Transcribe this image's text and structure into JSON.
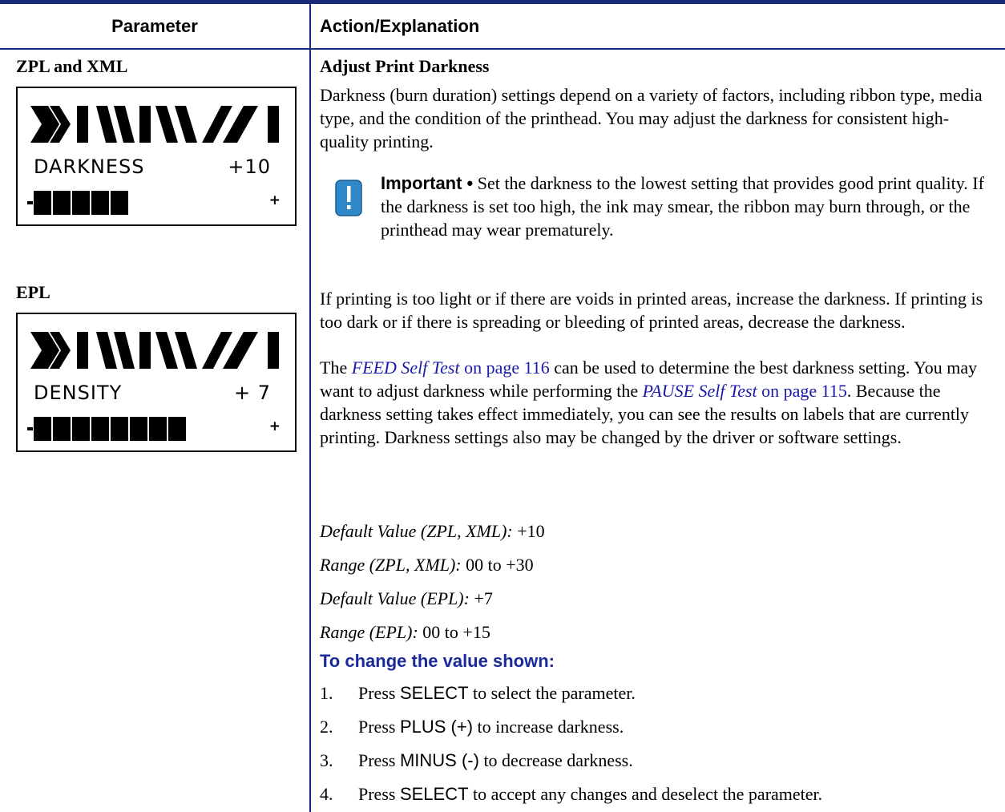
{
  "table": {
    "header_parameter": "Parameter",
    "header_action": "Action/Explanation"
  },
  "left": {
    "zpl_label": "ZPL and XML",
    "zpl_display": {
      "name": "DARKNESS",
      "value": "+10",
      "minus": "-",
      "plus": "+",
      "bar_blocks": 5
    },
    "epl_label": "EPL",
    "epl_display": {
      "name": "DENSITY",
      "value": "+ 7",
      "minus": "-",
      "plus": "+",
      "bar_blocks": 8
    }
  },
  "content": {
    "title": "Adjust Print Darkness",
    "intro": "Darkness (burn duration) settings depend on a variety of factors, including ribbon type, media type, and the condition of the printhead. You may adjust the darkness for consistent high-quality printing.",
    "important_label": "Important •",
    "important_text": "Set the darkness to the lowest setting that provides good print quality. If the darkness is set too high, the ink may smear, the ribbon may burn through, or the printhead may wear prematurely.",
    "para2": "If printing is too light or if there are voids in printed areas, increase the darkness. If printing is too dark or if there is spreading or bleeding of printed areas, decrease the darkness.",
    "para3_pre": "The ",
    "feed_link": "FEED Self Test",
    "feed_page": " on page 116",
    "para3_mid": " can be used to determine the best darkness setting. You may want to adjust darkness while performing the ",
    "pause_link": "PAUSE Self Test",
    "pause_page": " on page 115",
    "para3_post": ". Because the darkness setting takes effect immediately, you can see the results on labels that are currently printing. Darkness settings also may be changed by the driver or software settings.",
    "defaults": [
      {
        "label": "Default Value (ZPL, XML):",
        "value": " +10"
      },
      {
        "label": "Range (ZPL, XML):",
        "value": " 00 to +30"
      },
      {
        "label": "Default Value (EPL):",
        "value": " +7"
      },
      {
        "label": "Range (EPL):",
        "value": " 00 to +15"
      }
    ],
    "procedure_title": "To change the value shown:",
    "steps": [
      {
        "num": "1.",
        "pre": "Press ",
        "key": "SELECT",
        "post": " to select the parameter."
      },
      {
        "num": "2.",
        "pre": "Press ",
        "key": "PLUS (+)",
        "post": " to increase darkness."
      },
      {
        "num": "3.",
        "pre": "Press ",
        "key": "MINUS (-)",
        "post": " to decrease darkness."
      },
      {
        "num": "4.",
        "pre": "Press ",
        "key": "SELECT",
        "post": " to accept any changes and deselect the parameter."
      }
    ]
  },
  "colors": {
    "rule": "#1a2a7a",
    "link": "#1a1aa8",
    "heading": "#1a2a9a"
  }
}
